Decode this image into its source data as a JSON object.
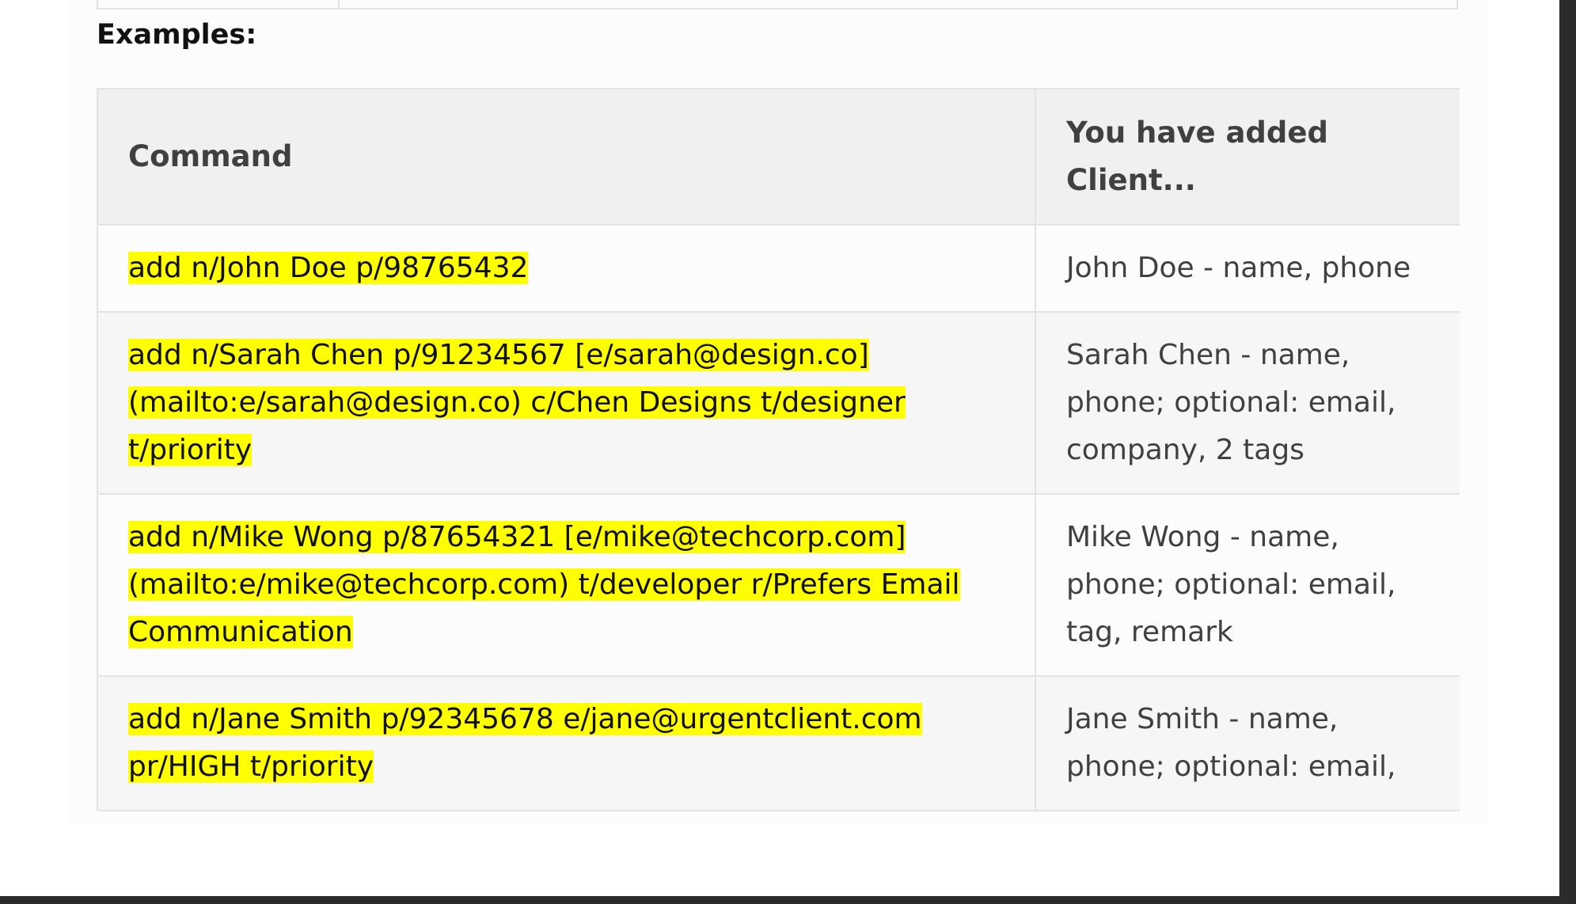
{
  "section": {
    "heading": "Examples:"
  },
  "table": {
    "headers": {
      "command": "Command",
      "result": "You have added Client..."
    },
    "rows": [
      {
        "command": "add n/John Doe p/98765432",
        "result": "John Doe - name, phone"
      },
      {
        "command": "add n/Sarah Chen p/91234567 [e/sarah@design.co](mailto:e/sarah@design.co) c/Chen Designs t/designer t/priority",
        "result": "Sarah Chen - name, phone; optional: email, company, 2 tags"
      },
      {
        "command": "add n/Mike Wong p/87654321 [e/mike@techcorp.com](mailto:e/mike@techcorp.com) t/developer r/Prefers Email Communication",
        "result": "Mike Wong - name, phone; optional: email, tag, remark"
      },
      {
        "command": "add n/Jane Smith p/92345678 e/jane@urgentclient.com pr/HIGH t/priority",
        "result": "Jane Smith - name, phone; optional: email,"
      }
    ]
  },
  "colors": {
    "highlight": "#ffff00",
    "header_bg": "#f0f0f0",
    "border": "#e3e3e3",
    "text": "#404040"
  }
}
